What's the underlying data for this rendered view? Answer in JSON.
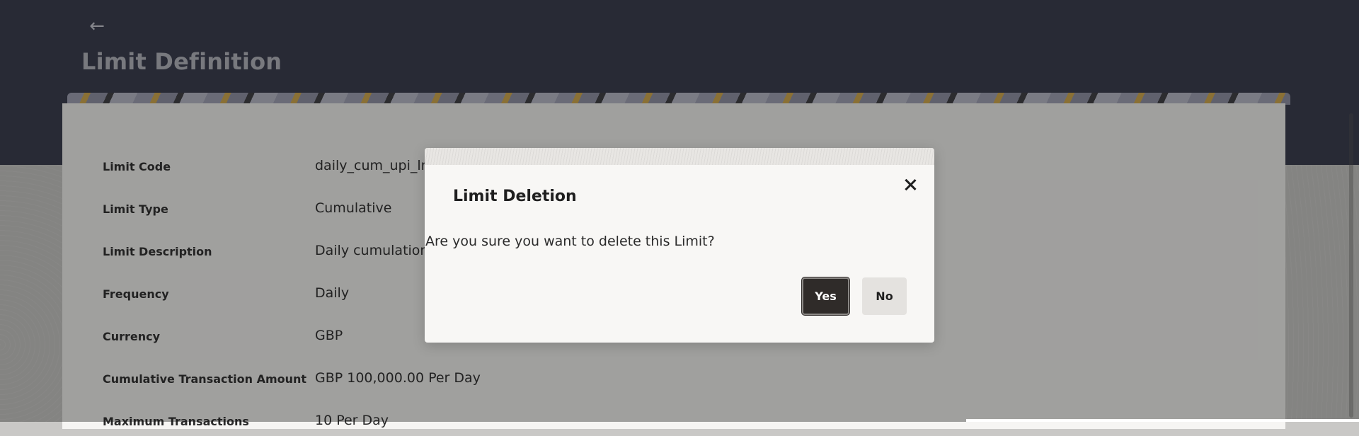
{
  "header": {
    "back_icon": "arrow-left-icon",
    "title": "Limit Definition"
  },
  "details": [
    {
      "label": "Limit Code",
      "value": "daily_cum_upi_lmt"
    },
    {
      "label": "Limit Type",
      "value": "Cumulative"
    },
    {
      "label": "Limit Description",
      "value": "Daily cumulation limit"
    },
    {
      "label": "Frequency",
      "value": "Daily"
    },
    {
      "label": "Currency",
      "value": "GBP"
    },
    {
      "label": "Cumulative Transaction Amount",
      "value": "GBP 100,000.00 Per Day"
    },
    {
      "label": "Maximum Transactions",
      "value": "10 Per Day"
    }
  ],
  "modal": {
    "title": "Limit Deletion",
    "close_icon": "close-icon",
    "message": "Are you sure you want to delete this Limit?",
    "yes_label": "Yes",
    "no_label": "No"
  },
  "colors": {
    "header_bg": "#343749",
    "primary_button": "#2f2b29",
    "secondary_button": "#e4e2df",
    "accent_gold": "#d2a84a"
  }
}
